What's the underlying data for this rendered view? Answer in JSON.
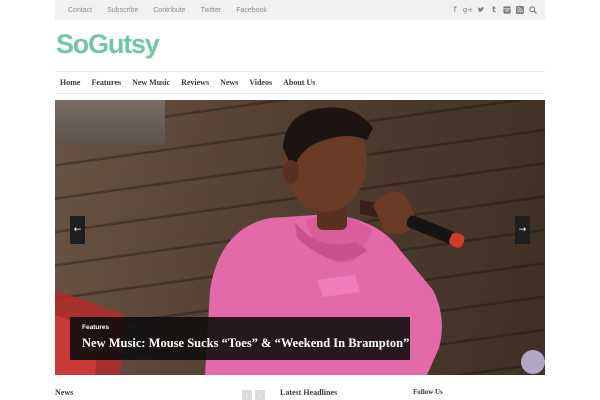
{
  "topbar": {
    "links": [
      "Contact",
      "Subscribe",
      "Contribute",
      "Twitter",
      "Facebook"
    ],
    "social_icons": [
      "facebook-icon",
      "google-plus-icon",
      "twitter-icon",
      "tumblr-icon",
      "instagram-icon",
      "rss-icon",
      "search-icon"
    ]
  },
  "logo": {
    "text": "SoGutsy",
    "color": "#70c8a1"
  },
  "nav": {
    "items": [
      "Home",
      "Features",
      "New Music",
      "Reviews",
      "News",
      "Videos",
      "About Us"
    ]
  },
  "slider": {
    "category": "Features",
    "title": "New Music: Mouse Sucks “Toes” & “Weekend In Brampton”"
  },
  "sections": {
    "news_heading": "News",
    "latest_heading": "Latest Headlines",
    "follow_heading": "Follow Us"
  }
}
